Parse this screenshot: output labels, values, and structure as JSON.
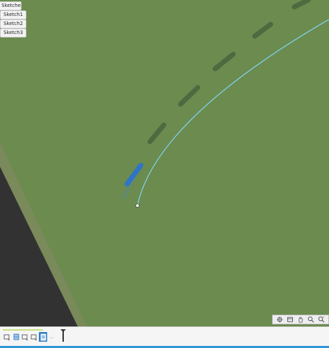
{
  "browser": {
    "header_label": "Sketches",
    "items": [
      {
        "label": "Sketch1"
      },
      {
        "label": "Sketch2"
      },
      {
        "label": "Sketch3"
      }
    ]
  },
  "canvas": {
    "background_color": "#6b8b4f",
    "path_color": "#7fd0e8",
    "selection_color": "#2f74c8"
  },
  "nav_toolbar": {
    "icons": [
      "orbit-icon",
      "look-at-icon",
      "pan-icon",
      "zoom-icon",
      "fit-icon"
    ]
  },
  "timeline": {
    "icons": [
      "sketch-icon",
      "extrude-icon",
      "sketch-icon",
      "sketch-icon",
      "sketch-icon-active"
    ]
  },
  "colors": {
    "accent": "#2f95d6",
    "toolbar_bg": "#f5f5f5"
  }
}
